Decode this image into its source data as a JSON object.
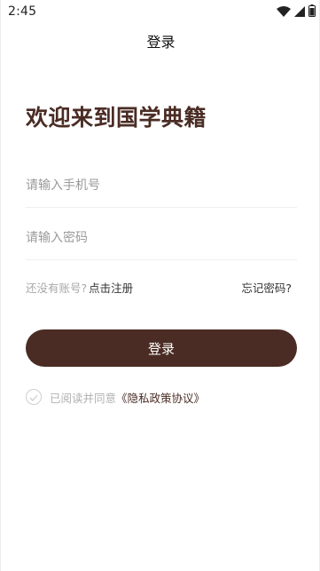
{
  "status_bar": {
    "time": "2:45",
    "icons": [
      "wifi-icon",
      "signal-icon",
      "battery-icon"
    ]
  },
  "app_bar": {
    "title": "登录"
  },
  "welcome_title": "欢迎来到国学典籍",
  "form": {
    "phone_placeholder": "请输入手机号",
    "phone_value": "",
    "password_placeholder": "请输入密码",
    "password_value": ""
  },
  "links": {
    "no_account_text": "还没有账号?",
    "register_label": "点击注册",
    "forgot_label": "忘记密码?"
  },
  "login_button_label": "登录",
  "agreement": {
    "checked": false,
    "text": "已阅读并同意",
    "policy_label": "《隐私政策协议》"
  },
  "colors": {
    "accent": "#4a2c24",
    "placeholder": "#9a9a9a",
    "muted": "#a8a8a8"
  }
}
